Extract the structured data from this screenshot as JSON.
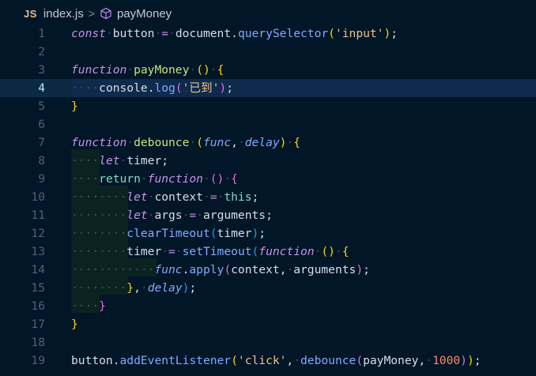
{
  "breadcrumb": {
    "badge": "JS",
    "file": "index.js",
    "separator": ">",
    "symbol": "payMoney"
  },
  "editor": {
    "current_line": 4,
    "lines": [
      {
        "n": "1",
        "tokens": [
          [
            "k",
            "const"
          ],
          [
            "ws",
            "·"
          ],
          [
            "v",
            "button"
          ],
          [
            "ws",
            "·"
          ],
          [
            "op",
            "="
          ],
          [
            "ws",
            "·"
          ],
          [
            "v",
            "document"
          ],
          [
            "d",
            "."
          ],
          [
            "f",
            "querySelector"
          ],
          [
            "b1",
            "("
          ],
          [
            "str",
            "'input'"
          ],
          [
            "b1",
            ")"
          ],
          [
            "d",
            ";"
          ]
        ]
      },
      {
        "n": "2",
        "tokens": []
      },
      {
        "n": "3",
        "tokens": [
          [
            "k",
            "function"
          ],
          [
            "ws",
            "·"
          ],
          [
            "fn",
            "payMoney"
          ],
          [
            "ws",
            "·"
          ],
          [
            "b1",
            "()"
          ],
          [
            "ws",
            "·"
          ],
          [
            "b1",
            "{"
          ]
        ]
      },
      {
        "n": "4",
        "tokens": [
          [
            "ws",
            "····"
          ],
          [
            "v",
            "console"
          ],
          [
            "d",
            "."
          ],
          [
            "f",
            "log"
          ],
          [
            "b2",
            "("
          ],
          [
            "str",
            "'已到'"
          ],
          [
            "b2",
            ")"
          ],
          [
            "d",
            ";"
          ]
        ]
      },
      {
        "n": "5",
        "tokens": [
          [
            "b1",
            "}"
          ]
        ]
      },
      {
        "n": "6",
        "tokens": []
      },
      {
        "n": "7",
        "tokens": [
          [
            "k",
            "function"
          ],
          [
            "ws",
            "·"
          ],
          [
            "fn",
            "debounce"
          ],
          [
            "ws",
            "·"
          ],
          [
            "b1",
            "("
          ],
          [
            "fnv",
            "func"
          ],
          [
            "d",
            ","
          ],
          [
            "ws",
            "·"
          ],
          [
            "fnv",
            "delay"
          ],
          [
            "b1",
            ")"
          ],
          [
            "ws",
            "·"
          ],
          [
            "b1",
            "{"
          ]
        ]
      },
      {
        "n": "8",
        "tokens": [
          [
            "ws",
            "····"
          ],
          [
            "k",
            "let"
          ],
          [
            "ws",
            "·"
          ],
          [
            "v",
            "timer"
          ],
          [
            "d",
            ";"
          ]
        ]
      },
      {
        "n": "9",
        "tokens": [
          [
            "ws",
            "····"
          ],
          [
            "p",
            "return"
          ],
          [
            "ws",
            "·"
          ],
          [
            "k",
            "function"
          ],
          [
            "ws",
            "·"
          ],
          [
            "b2",
            "()"
          ],
          [
            "ws",
            "·"
          ],
          [
            "b2",
            "{"
          ]
        ]
      },
      {
        "n": "10",
        "tokens": [
          [
            "ws",
            "········"
          ],
          [
            "k",
            "let"
          ],
          [
            "ws",
            "·"
          ],
          [
            "v",
            "context"
          ],
          [
            "ws",
            "·"
          ],
          [
            "op",
            "="
          ],
          [
            "ws",
            "·"
          ],
          [
            "this",
            "this"
          ],
          [
            "d",
            ";"
          ]
        ]
      },
      {
        "n": "11",
        "tokens": [
          [
            "ws",
            "········"
          ],
          [
            "k",
            "let"
          ],
          [
            "ws",
            "·"
          ],
          [
            "v",
            "args"
          ],
          [
            "ws",
            "·"
          ],
          [
            "op",
            "="
          ],
          [
            "ws",
            "·"
          ],
          [
            "v",
            "arguments"
          ],
          [
            "d",
            ";"
          ]
        ]
      },
      {
        "n": "12",
        "tokens": [
          [
            "ws",
            "········"
          ],
          [
            "f",
            "clearTimeout"
          ],
          [
            "b3",
            "("
          ],
          [
            "v",
            "timer"
          ],
          [
            "b3",
            ")"
          ],
          [
            "d",
            ";"
          ]
        ]
      },
      {
        "n": "13",
        "tokens": [
          [
            "ws",
            "········"
          ],
          [
            "v",
            "timer"
          ],
          [
            "ws",
            "·"
          ],
          [
            "op",
            "="
          ],
          [
            "ws",
            "·"
          ],
          [
            "f",
            "setTimeout"
          ],
          [
            "b3",
            "("
          ],
          [
            "k",
            "function"
          ],
          [
            "ws",
            "·"
          ],
          [
            "b1",
            "()"
          ],
          [
            "ws",
            "·"
          ],
          [
            "b1",
            "{"
          ]
        ]
      },
      {
        "n": "14",
        "tokens": [
          [
            "ws",
            "············"
          ],
          [
            "fnv",
            "func"
          ],
          [
            "d",
            "."
          ],
          [
            "f",
            "apply"
          ],
          [
            "b2",
            "("
          ],
          [
            "v",
            "context"
          ],
          [
            "d",
            ","
          ],
          [
            "ws",
            "·"
          ],
          [
            "v",
            "arguments"
          ],
          [
            "b2",
            ")"
          ],
          [
            "d",
            ";"
          ]
        ]
      },
      {
        "n": "15",
        "tokens": [
          [
            "ws",
            "········"
          ],
          [
            "b1",
            "}"
          ],
          [
            "d",
            ","
          ],
          [
            "ws",
            "·"
          ],
          [
            "fnv",
            "delay"
          ],
          [
            "b3",
            ")"
          ],
          [
            "d",
            ";"
          ]
        ]
      },
      {
        "n": "16",
        "tokens": [
          [
            "ws",
            "····"
          ],
          [
            "b2",
            "}"
          ]
        ]
      },
      {
        "n": "17",
        "tokens": [
          [
            "b1",
            "}"
          ]
        ]
      },
      {
        "n": "18",
        "tokens": []
      },
      {
        "n": "19",
        "tokens": [
          [
            "v",
            "button"
          ],
          [
            "d",
            "."
          ],
          [
            "f",
            "addEventListener"
          ],
          [
            "b1",
            "("
          ],
          [
            "str",
            "'click'"
          ],
          [
            "d",
            ","
          ],
          [
            "ws",
            "·"
          ],
          [
            "f",
            "debounce"
          ],
          [
            "b2",
            "("
          ],
          [
            "v",
            "payMoney"
          ],
          [
            "d",
            ","
          ],
          [
            "ws",
            "·"
          ],
          [
            "num",
            "1000"
          ],
          [
            "b2",
            ")"
          ],
          [
            "b1",
            ")"
          ],
          [
            "d",
            ";"
          ]
        ]
      }
    ]
  },
  "colors": {
    "background": "#011627",
    "current_line": "#0e2a4c",
    "keyword": "#c792ea",
    "function": "#82aaff",
    "string": "#ecc48d",
    "number": "#f78c6c"
  }
}
